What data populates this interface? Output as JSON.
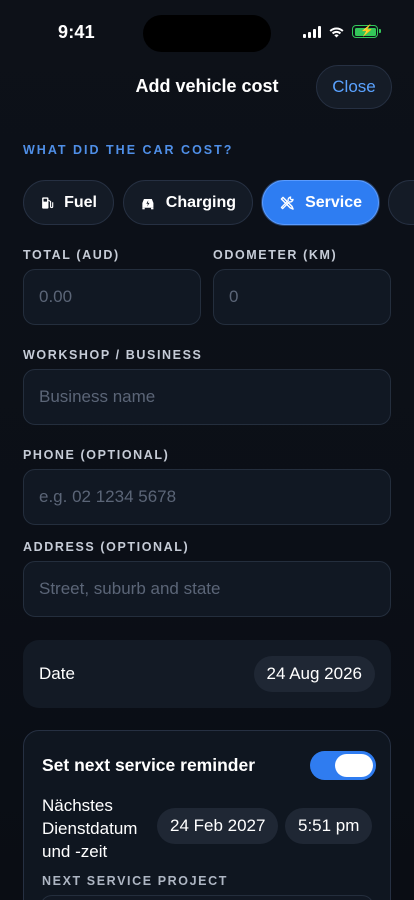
{
  "status_bar": {
    "time": "9:41"
  },
  "header": {
    "title": "Add vehicle cost",
    "close_label": "Close"
  },
  "cost_type": {
    "label": "WHAT DID THE CAR COST?",
    "chips": [
      {
        "label": "Fuel",
        "icon": "fuel-pump-icon",
        "selected": false
      },
      {
        "label": "Charging",
        "icon": "ev-charging-icon",
        "selected": false
      },
      {
        "label": "Service",
        "icon": "tools-icon",
        "selected": true
      }
    ]
  },
  "form": {
    "total": {
      "label": "TOTAL (AUD)",
      "placeholder": "0.00"
    },
    "odometer": {
      "label": "ODOMETER (KM)",
      "placeholder": "0"
    },
    "workshop": {
      "label": "WORKSHOP / BUSINESS",
      "placeholder": "Business name"
    },
    "phone": {
      "label": "PHONE (OPTIONAL)",
      "placeholder": "e.g. 02 1234 5678"
    },
    "address": {
      "label": "ADDRESS (OPTIONAL)",
      "placeholder": "Street, suburb and state"
    }
  },
  "date": {
    "label": "Date",
    "value": "24 Aug 2026"
  },
  "reminder": {
    "title": "Set next service reminder",
    "enabled": true,
    "next_label": "Nächstes Dienstdatum und -zeit",
    "next_date": "24 Feb 2027",
    "next_time": "5:51 pm",
    "project_label": "NEXT SERVICE PROJECT"
  },
  "colors": {
    "accent": "#2e7df2",
    "background": "#0b0f17",
    "battery": "#34c759"
  }
}
